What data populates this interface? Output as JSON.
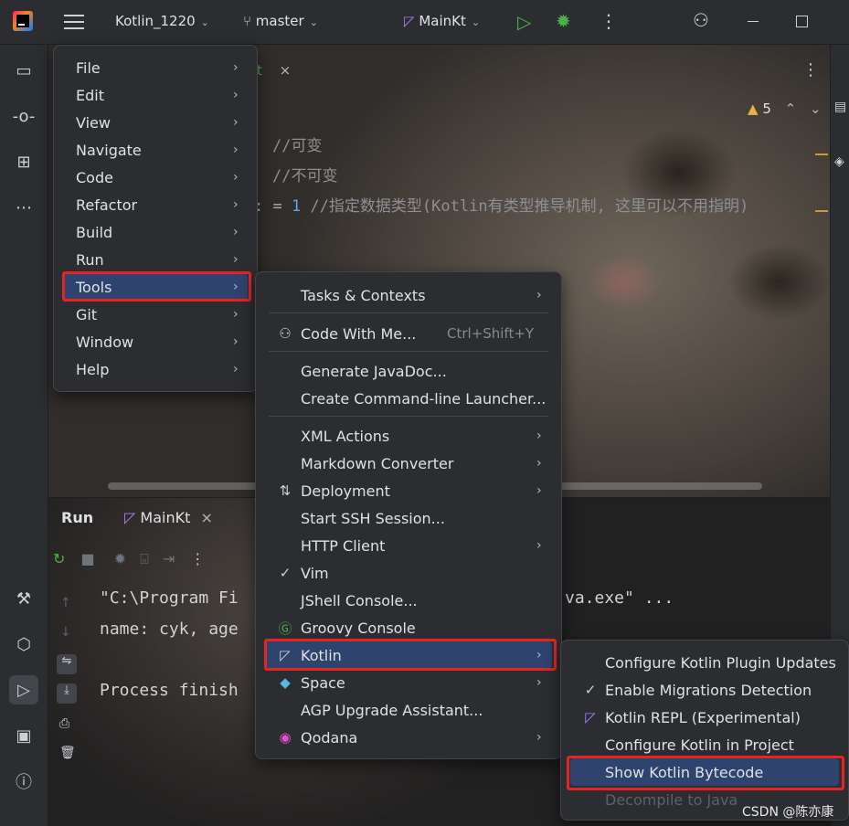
{
  "titlebar": {
    "project": "Kotlin_1220",
    "branch": "master",
    "run_config": "MainKt"
  },
  "editor": {
    "tab_fragment": "t",
    "warnings_count": "5",
    "line1": "//可变",
    "line2": "//不可变",
    "line3_prefix": ": = ",
    "line3_number": "1",
    "line3_comment": "//指定数据类型(Kotlin有类型推导机制, 这里可以不用指明)"
  },
  "run_panel": {
    "title": "Run",
    "tab": "MainKt",
    "console_lines": [
      "\"C:\\Program Fi",
      "va.exe\" ...",
      "name: cyk, age",
      "Process finish"
    ]
  },
  "main_menu": {
    "items": [
      {
        "label": "File"
      },
      {
        "label": "Edit"
      },
      {
        "label": "View"
      },
      {
        "label": "Navigate"
      },
      {
        "label": "Code"
      },
      {
        "label": "Refactor"
      },
      {
        "label": "Build"
      },
      {
        "label": "Run"
      },
      {
        "label": "Tools"
      },
      {
        "label": "Git"
      },
      {
        "label": "Window"
      },
      {
        "label": "Help"
      }
    ]
  },
  "tools_menu": {
    "items": [
      {
        "label": "Tasks & Contexts",
        "shortcut": ""
      },
      {
        "label": "Code With Me...",
        "shortcut": "Ctrl+Shift+Y"
      },
      {
        "label": "Generate JavaDoc..."
      },
      {
        "label": "Create Command-line Launcher..."
      },
      {
        "label": "XML Actions"
      },
      {
        "label": "Markdown Converter"
      },
      {
        "label": "Deployment"
      },
      {
        "label": "Start SSH Session..."
      },
      {
        "label": "HTTP Client"
      },
      {
        "label": "Vim"
      },
      {
        "label": "JShell Console..."
      },
      {
        "label": "Groovy Console"
      },
      {
        "label": "Kotlin"
      },
      {
        "label": "Space"
      },
      {
        "label": "AGP Upgrade Assistant..."
      },
      {
        "label": "Qodana"
      }
    ]
  },
  "kotlin_menu": {
    "items": [
      {
        "label": "Configure Kotlin Plugin Updates"
      },
      {
        "label": "Enable Migrations Detection"
      },
      {
        "label": "Kotlin REPL (Experimental)"
      },
      {
        "label": "Configure Kotlin in Project"
      },
      {
        "label": "Show Kotlin Bytecode"
      },
      {
        "label": "Decompile to Java"
      }
    ]
  },
  "watermark": "CSDN @陈亦康",
  "colors": {
    "menu_bg": "#2b2d30",
    "selection": "#2e436e",
    "highlight_box": "#e52424",
    "run_green": "#4fb049"
  }
}
